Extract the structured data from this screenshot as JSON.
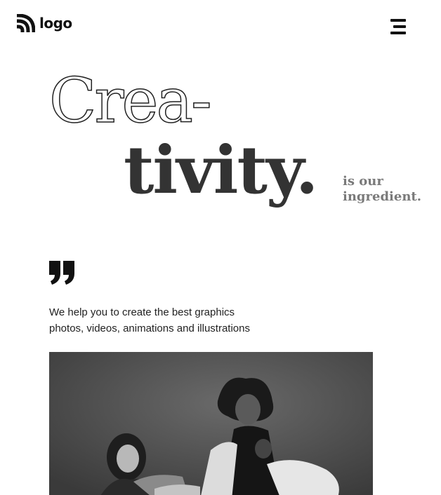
{
  "header": {
    "logo_text": "logo",
    "logo_icon": "logo-mark-icon",
    "menu_icon": "hamburger-menu-icon"
  },
  "hero": {
    "line1": "Crea-",
    "line2": "tivity.",
    "tagline_line1": "is our",
    "tagline_line2": "ingredient."
  },
  "quote": {
    "icon": "quote-icon",
    "line1": "We help you to create the best graphics",
    "line2": "photos, videos, animations and illustrations"
  },
  "photo": {
    "subject": "black-and-white photo of dancers",
    "style": "grayscale"
  },
  "colors": {
    "text_dark": "#333333",
    "text_muted": "#7a7a7a",
    "background": "#ffffff",
    "icon": "#111111"
  }
}
